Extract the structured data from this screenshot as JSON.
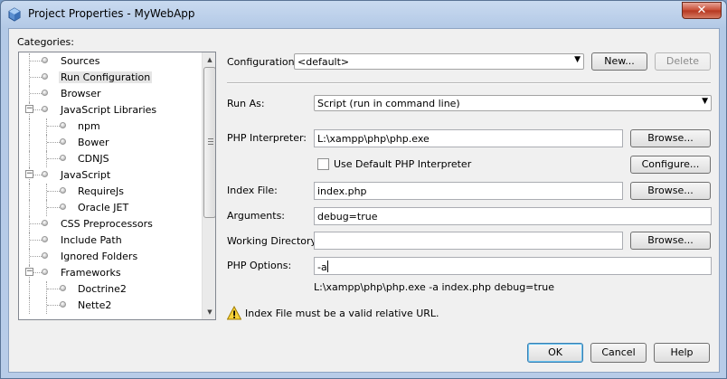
{
  "window": {
    "title": "Project Properties - MyWebApp",
    "close_label": "✕"
  },
  "categories": {
    "label": "Categories:",
    "items": [
      {
        "label": "Sources",
        "level": 0,
        "expander": ""
      },
      {
        "label": "Run Configuration",
        "level": 0,
        "expander": "",
        "selected": true
      },
      {
        "label": "Browser",
        "level": 0,
        "expander": ""
      },
      {
        "label": "JavaScript Libraries",
        "level": 0,
        "expander": "−"
      },
      {
        "label": "npm",
        "level": 1,
        "expander": ""
      },
      {
        "label": "Bower",
        "level": 1,
        "expander": ""
      },
      {
        "label": "CDNJS",
        "level": 1,
        "expander": ""
      },
      {
        "label": "JavaScript",
        "level": 0,
        "expander": "−"
      },
      {
        "label": "RequireJs",
        "level": 1,
        "expander": ""
      },
      {
        "label": "Oracle JET",
        "level": 1,
        "expander": ""
      },
      {
        "label": "CSS Preprocessors",
        "level": 0,
        "expander": ""
      },
      {
        "label": "Include Path",
        "level": 0,
        "expander": ""
      },
      {
        "label": "Ignored Folders",
        "level": 0,
        "expander": ""
      },
      {
        "label": "Frameworks",
        "level": 0,
        "expander": "−"
      },
      {
        "label": "Doctrine2",
        "level": 1,
        "expander": ""
      },
      {
        "label": "Nette2",
        "level": 1,
        "expander": ""
      }
    ],
    "scroll_up": "▲",
    "scroll_down": "▼"
  },
  "configuration": {
    "label": "Configuration:",
    "value": "<default>",
    "arrow": "▼",
    "new_label": "New...",
    "delete_label": "Delete"
  },
  "run_as": {
    "label": "Run As:",
    "value": "Script (run in command line)",
    "arrow": "▼"
  },
  "php_interpreter": {
    "label": "PHP Interpreter:",
    "value": "L:\\xampp\\php\\php.exe",
    "browse_label": "Browse..."
  },
  "use_default": {
    "label": "Use Default PHP Interpreter",
    "checked": false,
    "configure_label": "Configure..."
  },
  "index_file": {
    "label": "Index File:",
    "value": "index.php",
    "browse_label": "Browse..."
  },
  "arguments": {
    "label": "Arguments:",
    "value": "debug=true"
  },
  "working_directory": {
    "label": "Working Directory:",
    "value": "",
    "browse_label": "Browse..."
  },
  "php_options": {
    "label": "PHP Options:",
    "value": "-a"
  },
  "command_preview": "L:\\xampp\\php\\php.exe -a index.php debug=true",
  "warning": {
    "text": "Index File must be a valid relative URL."
  },
  "footer": {
    "ok_label": "OK",
    "cancel_label": "Cancel",
    "help_label": "Help"
  }
}
